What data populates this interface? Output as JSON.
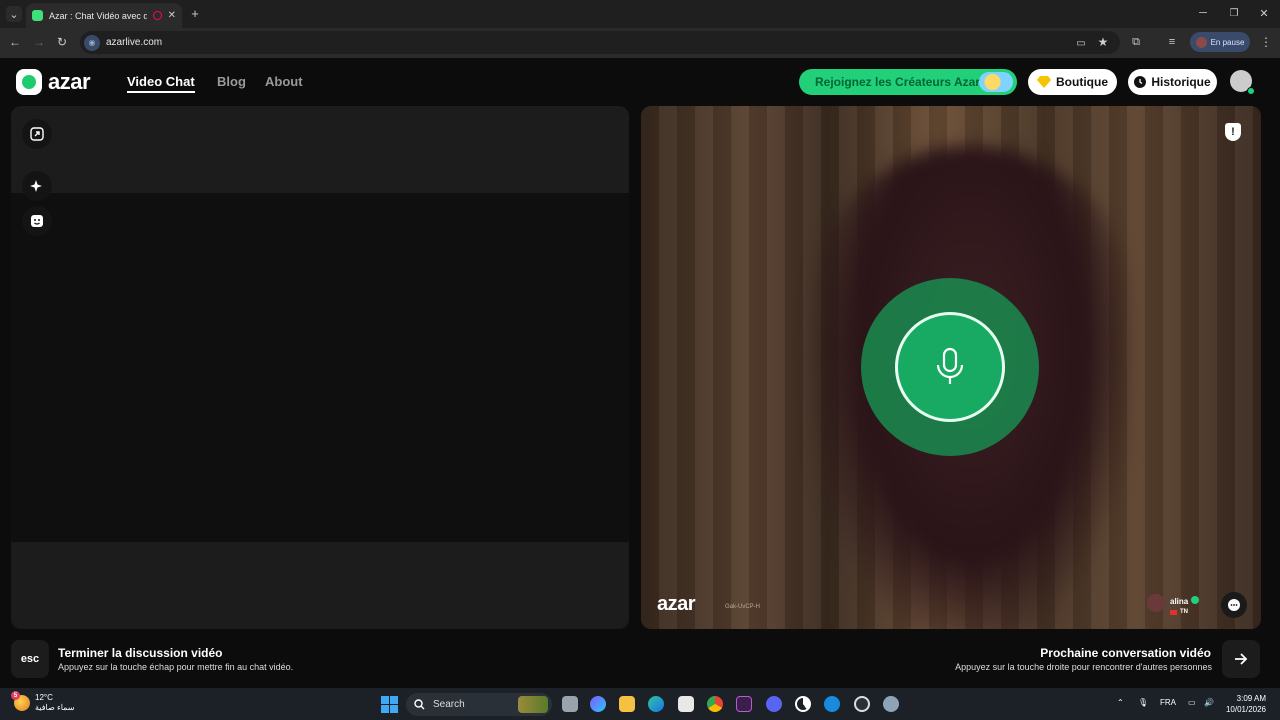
{
  "browser": {
    "tab_title": "Azar : Chat Vidéo avec de n",
    "new_tab": "+",
    "url": "azarlive.com",
    "profile_status": "En pause",
    "window_controls": [
      "minimize-icon",
      "maximize-icon",
      "close-icon"
    ]
  },
  "header": {
    "logo_text": "azar",
    "nav": [
      "Video Chat",
      "Blog",
      "About"
    ],
    "creators_button": "Rejoignez les Créateurs Azar",
    "shop_button": "Boutique",
    "history_button": "Historique"
  },
  "remote": {
    "logo_text": "azar",
    "session_code": "Gak-UvCP-H",
    "user_name": "alina",
    "user_country": "TN"
  },
  "footer": {
    "esc_key": "esc",
    "end_title": "Terminer la discussion vidéo",
    "end_sub": "Appuyez sur la touche échap pour mettre fin au chat vidéo.",
    "next_title": "Prochaine conversation vidéo",
    "next_sub": "Appuyez sur la touche droite pour rencontrer d'autres personnes"
  },
  "taskbar": {
    "temperature": "12°C",
    "weather_desc": "سماء صافية",
    "weather_badge": "5",
    "search_placeholder": "Search",
    "language": "FRA",
    "time": "3:09 AM",
    "date": "10/01/2026"
  },
  "colors": {
    "accent_green": "#22d07a",
    "mic_green": "#18a962"
  }
}
